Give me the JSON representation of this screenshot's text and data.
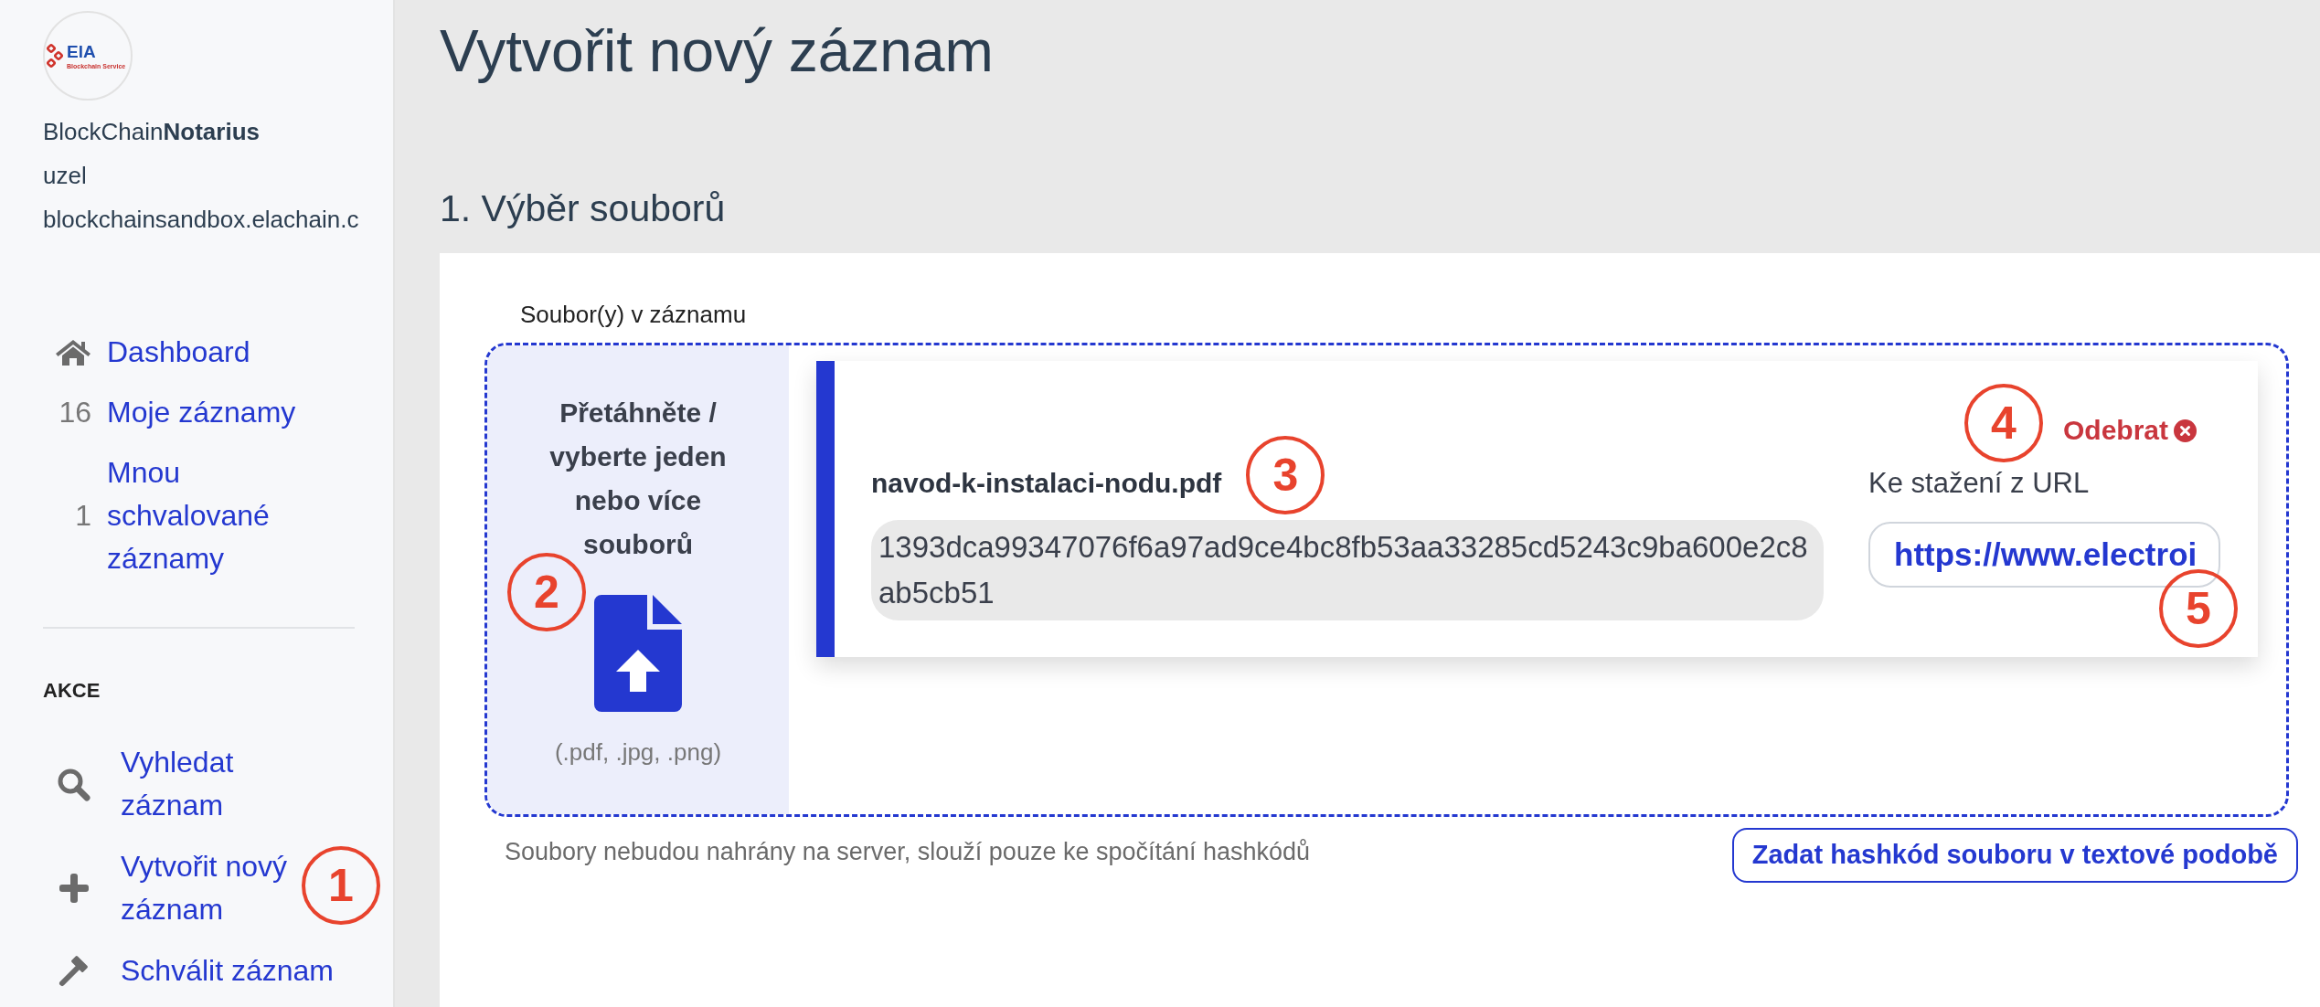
{
  "sidebar": {
    "logo": {
      "wordmark": "ElA",
      "tagline": "Blockchain Service"
    },
    "app_name": "BlockChain**Notarius**",
    "node_label": "uzel",
    "node_host": "blockchainsandbox.elachain.c",
    "nav": [
      {
        "label": "Dashboard"
      },
      {
        "count": "16",
        "label": "Moje záznamy"
      },
      {
        "count": "1",
        "label": "Mnou schvalované záznamy"
      }
    ],
    "actions_heading": "AKCE",
    "actions": [
      {
        "label": "Vyhledat záznam"
      },
      {
        "label": "Vytvořit nový záznam",
        "callout": "1"
      },
      {
        "label": "Schválit záznam"
      }
    ]
  },
  "page_title": "Vytvořit nový záznam",
  "section_title": "1. Výběr souborů",
  "files": {
    "label": "Soubor(y) v záznamu",
    "dropzone": {
      "text": "Přetáhněte / vyberte jeden nebo více souborů",
      "formats": "(.pdf, .jpg, .png)",
      "callout": "2"
    },
    "items": [
      {
        "name": "navod-k-instalaci-nodu.pdf",
        "name_callout": "3",
        "hash": "1393dca99347076f6a97ad9ce4bc8fb53aa33285cd5243c9ba600e2c8ab5cb51",
        "remove": "Odebrat",
        "remove_callout": "4",
        "url_label": "Ke stažení z URL",
        "url_value": "https://www.electroi",
        "url_callout": "5"
      }
    ],
    "note": "Soubory nebudou nahrány na server, slouží pouze ke spočítání hashkódů",
    "hash_button": "Zadat hashkód souboru v textové podobě"
  }
}
